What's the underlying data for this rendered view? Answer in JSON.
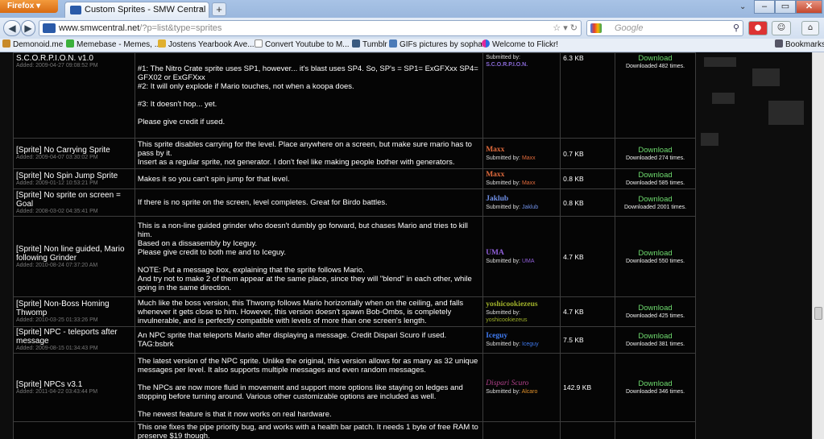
{
  "browser": {
    "app_button": "Firefox",
    "tab_title": "Custom Sprites - SMW Central",
    "url_domain": "www.smwcentral.net",
    "url_path": "/?p=list&type=sprites",
    "search_placeholder": "Google",
    "bookmarks_label": "Bookmarks",
    "bookmarks": [
      "Demonoid.me",
      "Memebase - Memes, ...",
      "Jostens Yearbook Ave...",
      "Convert Youtube to M...",
      "Tumblr",
      "GIFs pictures by sopha...",
      "Welcome to Flickr!"
    ]
  },
  "rows": [
    {
      "name": "S.C.O.R.P.I.O.N. v1.0",
      "added": "Added: 2009-04-27 09:08:52 PM",
      "desc": [
        "#1: The Nitro Crate sprite uses SP1, however... it's blast uses SP4. So, SP's = SP1= ExGFXxx SP4= GFX02 or ExGFXxx",
        "",
        "#2: It will only explode if Mario touches, not when a koopa does.",
        "",
        "#3: It doesn't hop... yet.",
        "",
        "Please give credit if used."
      ],
      "author": "",
      "submitted_label": "Submitted by:",
      "submitted_by": "S.C.O.R.P.I.O.N.",
      "author_color": "#8a6ad8",
      "size": "6.3 KB",
      "download": "Download",
      "downloads": "Downloaded 482 times."
    },
    {
      "name": "[Sprite] No Carrying Sprite",
      "added": "Added: 2009-04-07 03:30:02 PM",
      "desc": [
        "This sprite disables carrying for the level. Place anywhere on a screen, but make sure mario has to pass by it.",
        "Insert as a regular sprite, not generator. I don't feel like making people bother with generators."
      ],
      "author": "Maxx",
      "submitted_label": "Submitted by:",
      "submitted_by": "Maxx",
      "author_color": "#e06a3c",
      "size": "0.7 KB",
      "download": "Download",
      "downloads": "Downloaded 274 times."
    },
    {
      "name": "[Sprite] No Spin Jump Sprite",
      "added": "Added: 2009-01-12 10:53:21 PM",
      "desc": [
        "Makes it so you can't spin jump for that level."
      ],
      "author": "Maxx",
      "submitted_label": "Submitted by:",
      "submitted_by": "Maxx",
      "author_color": "#e06a3c",
      "size": "0.8 KB",
      "download": "Download",
      "downloads": "Downloaded 585 times."
    },
    {
      "name": "[Sprite] No sprite on screen = Goal",
      "added": "Added: 2008-03-02 04:35:41 PM",
      "desc": [
        "If there is no sprite on the screen, level completes. Great for Birdo battles."
      ],
      "author": "Jaklub",
      "submitted_label": "Submitted by:",
      "submitted_by": "Jaklub",
      "author_color": "#6f8fe6",
      "size": "0.8 KB",
      "download": "Download",
      "downloads": "Downloaded 2001 times."
    },
    {
      "name": "[Sprite] Non line guided, Mario following Grinder",
      "added": "Added: 2010-08-24 07:37:20 AM",
      "desc": [
        "This is a non-line guided grinder who doesn't dumbly go forward, but chases Mario and tries to kill him.",
        "Based on a dissasembly by Iceguy.",
        "Please give credit to both me and to Iceguy.",
        "",
        "NOTE: Put a message box, explaining that the sprite follows Mario.",
        "And try not to make 2 of them appear at the same place, since they will \"blend\" in each other, while going in the same direction."
      ],
      "author": "UMA",
      "submitted_label": "Submitted by:",
      "submitted_by": "UMA",
      "author_color": "#8f5fd8",
      "size": "4.7 KB",
      "download": "Download",
      "downloads": "Downloaded 550 times."
    },
    {
      "name": "[Sprite] Non-Boss Homing Thwomp",
      "added": "Added: 2010-03-25 01:33:26 PM",
      "desc": [
        "Much like the boss version, this Thwomp follows Mario horizontally when on the ceiling, and falls whenever it gets close to him. However, this version doesn't spawn Bob-Ombs, is completely invulnerable, and is perfectly compatible with levels of more than one screen's length."
      ],
      "author": "yoshicookiezeus",
      "submitted_label": "Submitted by:",
      "submitted_by": "yoshicookiezeus",
      "author_color": "#9fb02a",
      "size": "4.7 KB",
      "download": "Download",
      "downloads": "Downloaded 425 times."
    },
    {
      "name": "[Sprite] NPC - teleports after message",
      "added": "Added: 2009-08-15 01:34:43 PM",
      "desc": [
        "An NPC sprite that teleports Mario after displaying a message. Credit Dispari Scuro if used.",
        "TAG:bsbrk"
      ],
      "author": "Iceguy",
      "submitted_label": "Submitted by:",
      "submitted_by": "Iceguy",
      "author_color": "#3f7af0",
      "size": "7.5 KB",
      "download": "Download",
      "downloads": "Downloaded 381 times."
    },
    {
      "name": "[Sprite] NPCs v3.1",
      "added": "Added: 2011-04-22 03:43:44 PM",
      "desc": [
        "The latest version of the NPC sprite. Unlike the original, this version allows for as many as 32 unique messages per level. It also supports multiple messages and even random messages.",
        "",
        "The NPCs are now more fluid in movement and support more options like staying on ledges and stopping before turning around. Various other customizable options are included as well.",
        "",
        "The newest feature is that it now works on real hardware."
      ],
      "author": "Dispari Scuro",
      "submitted_label": "Submitted by:",
      "submitted_by": "Alcaro",
      "author_color": "#b0408a",
      "size": "142.9 KB",
      "download": "Download",
      "downloads": "Downloaded 346 times."
    },
    {
      "name": "",
      "added": "",
      "desc": [
        "This one fixes the pipe priority bug, and works with a health bar patch. It needs 1 byte of free RAM to preserve $19 though."
      ],
      "author": "",
      "submitted_label": "",
      "submitted_by": "",
      "author_color": "#ffffff",
      "size": "",
      "download": "",
      "downloads": ""
    }
  ]
}
